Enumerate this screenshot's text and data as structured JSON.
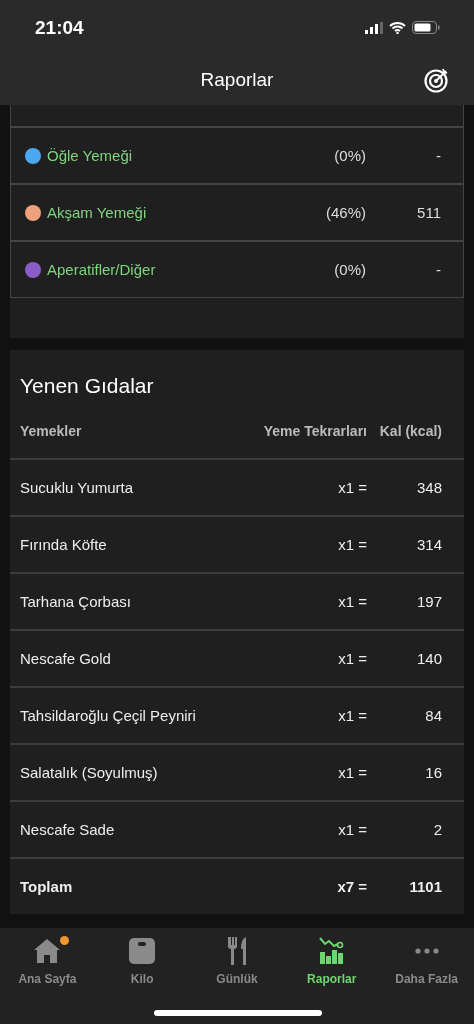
{
  "status_bar": {
    "time": "21:04"
  },
  "nav": {
    "title": "Raporlar"
  },
  "meals": [
    {
      "name": "Öğle Yemeği",
      "color": "#4aa8f0",
      "percent": "(0%)",
      "kcal": "-"
    },
    {
      "name": "Akşam Yemeği",
      "color": "#f0a07a",
      "percent": "(46%)",
      "kcal": "511"
    },
    {
      "name": "Aperatifler/Diğer",
      "color": "#8a5cc8",
      "percent": "(0%)",
      "kcal": "-"
    }
  ],
  "foods": {
    "title": "Yenen Gıdalar",
    "columns": [
      "Yemekler",
      "Yeme Tekrarları",
      "Kal (kcal)"
    ],
    "rows": [
      {
        "name": "Sucuklu Yumurta",
        "count": "x1 =",
        "kcal": "348"
      },
      {
        "name": "Fırında Köfte",
        "count": "x1 =",
        "kcal": "314"
      },
      {
        "name": "Tarhana Çorbası",
        "count": "x1 =",
        "kcal": "197"
      },
      {
        "name": "Nescafe Gold",
        "count": "x1 =",
        "kcal": "140"
      },
      {
        "name": "Tahsildaroğlu Çeçil Peyniri",
        "count": "x1 =",
        "kcal": "84"
      },
      {
        "name": "Salatalık (Soyulmuş)",
        "count": "x1 =",
        "kcal": "16"
      },
      {
        "name": "Nescafe Sade",
        "count": "x1 =",
        "kcal": "2"
      }
    ],
    "total": {
      "name": "Toplam",
      "count": "x7 =",
      "kcal": "1101"
    }
  },
  "tabs": [
    {
      "label": "Ana Sayfa",
      "kind": "home",
      "selected": false,
      "badge": true
    },
    {
      "label": "Kilo",
      "kind": "scale",
      "selected": false,
      "badge": false
    },
    {
      "label": "Günlük",
      "kind": "diary",
      "selected": false,
      "badge": false
    },
    {
      "label": "Raporlar",
      "kind": "reports",
      "selected": true,
      "badge": false
    },
    {
      "label": "Daha Fazla",
      "kind": "more",
      "selected": false,
      "badge": false
    }
  ]
}
